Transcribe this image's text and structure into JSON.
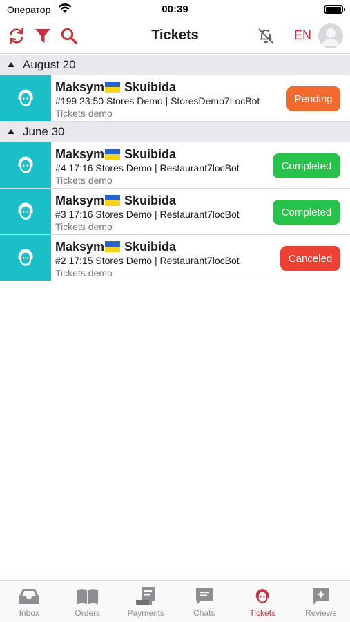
{
  "status_bar": {
    "carrier": "Оператор",
    "time": "00:39"
  },
  "header": {
    "title": "Tickets",
    "language": "EN"
  },
  "colors": {
    "accent": "#c4343f",
    "ticket_icon_bg": "#1bbfc8",
    "pending": "#f26a2e",
    "completed": "#27c14b",
    "canceled": "#ee4136"
  },
  "sections": [
    {
      "title": "August 20",
      "tickets": [
        {
          "first_name": "Maksym",
          "last_name": "Skuibida",
          "details": "#199 23:50 Stores Demo | StoresDemo7LocBot",
          "subtitle": "Tickets demo",
          "status": "Pending"
        }
      ]
    },
    {
      "title": "June 30",
      "tickets": [
        {
          "first_name": "Maksym",
          "last_name": "Skuibida",
          "details": "#4 17:16 Stores Demo | Restaurant7locBot",
          "subtitle": "Tickets demo",
          "status": "Completed"
        },
        {
          "first_name": "Maksym",
          "last_name": "Skuibida",
          "details": "#3 17:16 Stores Demo | Restaurant7locBot",
          "subtitle": "Tickets demo",
          "status": "Completed"
        },
        {
          "first_name": "Maksym",
          "last_name": "Skuibida",
          "details": "#2 17:15 Stores Demo | Restaurant7locBot",
          "subtitle": "Tickets demo",
          "status": "Canceled"
        }
      ]
    }
  ],
  "tabs": [
    {
      "label": "Inbox",
      "icon": "inbox-icon",
      "active": false
    },
    {
      "label": "Orders",
      "icon": "book-icon",
      "active": false
    },
    {
      "label": "Payments",
      "icon": "receipt-icon",
      "active": false
    },
    {
      "label": "Chats",
      "icon": "chat-bubble-icon",
      "active": false
    },
    {
      "label": "Tickets",
      "icon": "headset-icon",
      "active": true
    },
    {
      "label": "Reviews",
      "icon": "star-bubble-icon",
      "active": false
    }
  ]
}
